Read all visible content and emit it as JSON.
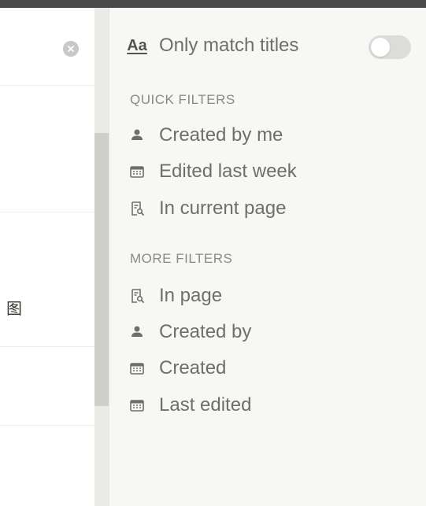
{
  "search_results": {
    "result_snippet": "图"
  },
  "filters": {
    "title_match": {
      "icon": "Aa",
      "label": "Only match titles",
      "enabled": false
    },
    "quick_filters": {
      "title": "QUICK FILTERS",
      "items": [
        {
          "label": "Created by me",
          "icon": "person-icon"
        },
        {
          "label": "Edited last week",
          "icon": "calendar-icon"
        },
        {
          "label": "In current page",
          "icon": "page-search-icon"
        }
      ]
    },
    "more_filters": {
      "title": "MORE FILTERS",
      "items": [
        {
          "label": "In page",
          "icon": "page-search-icon"
        },
        {
          "label": "Created by",
          "icon": "person-icon"
        },
        {
          "label": "Created",
          "icon": "calendar-icon"
        },
        {
          "label": "Last edited",
          "icon": "calendar-icon"
        }
      ]
    }
  },
  "colors": {
    "panel_bg": "#f7f7f5",
    "text": "#6f6e6b",
    "toggle_off": "#dcdcd8"
  }
}
